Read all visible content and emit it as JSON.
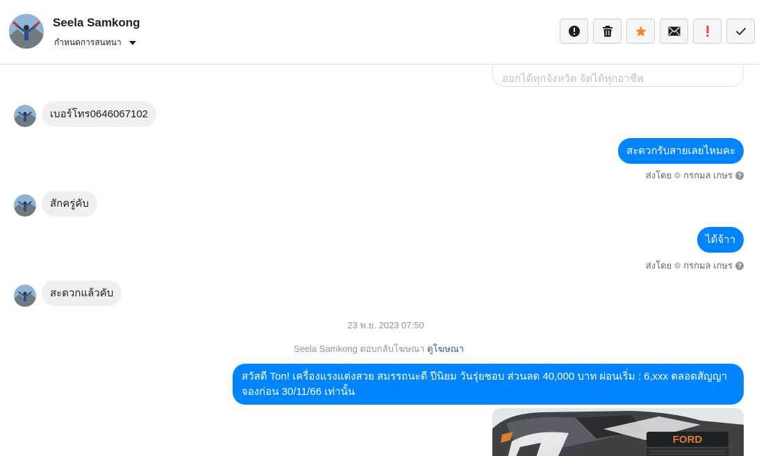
{
  "header": {
    "contact_name": "Seela Samkong",
    "assign_label": "กำหนดการสนทนา",
    "actions": [
      {
        "name": "spam-button",
        "icon": "alert-circle-icon"
      },
      {
        "name": "delete-button",
        "icon": "trash-icon"
      },
      {
        "name": "star-button",
        "icon": "star-icon",
        "color": "#f5891f"
      },
      {
        "name": "mark-unread-button",
        "icon": "envelope-icon"
      },
      {
        "name": "important-button",
        "icon": "exclamation-icon",
        "color": "#fa3e3e"
      },
      {
        "name": "done-button",
        "icon": "check-icon"
      }
    ]
  },
  "thread": {
    "top_partial_text": "ออกได้ทุกจังหวัด จัดได้ทุกอาชีพ",
    "messages": [
      {
        "direction": "in",
        "text": "เบอร์โทร0646067102"
      },
      {
        "direction": "out",
        "text": "สะดวกรับสายเลยไหมคะ",
        "sent_by_label": "ส่งโดย",
        "sent_by_name": "กรกมล เกษร"
      },
      {
        "direction": "in",
        "text": "สักครู่คับ"
      },
      {
        "direction": "out",
        "text": "ได้จ้าา",
        "sent_by_label": "ส่งโดย",
        "sent_by_name": "กรกมล เกษร"
      },
      {
        "direction": "in",
        "text": "สะดวกแล้วคับ"
      }
    ],
    "timestamp": "23 พ.ย. 2023 07:50",
    "ad_reply_text": "Seela Samkong ตอบกลับโฆษณา",
    "ad_reply_link": "ดูโฆษณา",
    "promo_message": "สวัสดี Ton!  เครื่องแรงแต่งสวย สมรรถนะดี ปีนิยม วันรุ่ยชอบ ส่วนลด 40,000 บาท ผ่อนเริ่ม :  6,xxx ตลอดสัญญา จองก่อน 30/11/66 เท่านั้น",
    "car_brand_text": "FORD"
  },
  "colors": {
    "accent": "#0084ff",
    "incoming_bubble": "#f1f0f0",
    "link": "#385898"
  }
}
